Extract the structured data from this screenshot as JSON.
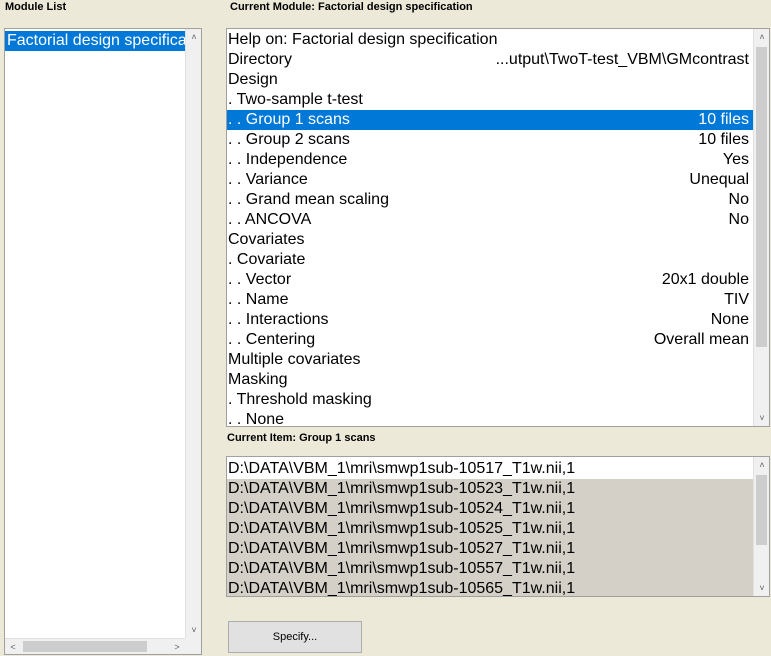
{
  "headers": {
    "module_list": "Module List",
    "current_module": "Current Module: Factorial design specification",
    "current_item": "Current Item: Group 1 scans"
  },
  "module_list": {
    "items": [
      {
        "label": "Factorial design specifica",
        "selected": true
      }
    ]
  },
  "settings": {
    "rows": [
      {
        "label": "Help on: Factorial design specification",
        "value": ""
      },
      {
        "label": "Directory",
        "value": "...utput\\TwoT-test_VBM\\GMcontrast"
      },
      {
        "label": "Design",
        "value": ""
      },
      {
        "label": ". Two-sample t-test",
        "value": ""
      },
      {
        "label": ". . Group 1 scans",
        "value": "10 files",
        "selected": true
      },
      {
        "label": ". . Group 2 scans",
        "value": "10 files"
      },
      {
        "label": ". . Independence",
        "value": "Yes"
      },
      {
        "label": ". . Variance",
        "value": "Unequal"
      },
      {
        "label": ". . Grand mean scaling",
        "value": "No"
      },
      {
        "label": ". . ANCOVA",
        "value": "No"
      },
      {
        "label": "Covariates",
        "value": ""
      },
      {
        "label": ". Covariate",
        "value": ""
      },
      {
        "label": ". . Vector",
        "value": "20x1 double"
      },
      {
        "label": ". . Name",
        "value": "TIV"
      },
      {
        "label": ". . Interactions",
        "value": "None"
      },
      {
        "label": ". . Centering",
        "value": "Overall mean"
      },
      {
        "label": "Multiple covariates",
        "value": ""
      },
      {
        "label": "Masking",
        "value": ""
      },
      {
        "label": ". Threshold masking",
        "value": ""
      },
      {
        "label": ". . None",
        "value": ""
      }
    ]
  },
  "current_item": {
    "files": [
      "D:\\DATA\\VBM_1\\mri\\smwp1sub-10517_T1w.nii,1",
      "D:\\DATA\\VBM_1\\mri\\smwp1sub-10523_T1w.nii,1",
      "D:\\DATA\\VBM_1\\mri\\smwp1sub-10524_T1w.nii,1",
      "D:\\DATA\\VBM_1\\mri\\smwp1sub-10525_T1w.nii,1",
      "D:\\DATA\\VBM_1\\mri\\smwp1sub-10527_T1w.nii,1",
      "D:\\DATA\\VBM_1\\mri\\smwp1sub-10557_T1w.nii,1",
      "D:\\DATA\\VBM_1\\mri\\smwp1sub-10565_T1w.nii,1"
    ]
  },
  "buttons": {
    "specify": "Specify..."
  },
  "icons": {
    "arrow_up": "chevron-up-icon",
    "arrow_down": "chevron-down-icon",
    "arrow_left": "chevron-left-icon",
    "arrow_right": "chevron-right-icon"
  },
  "colors": {
    "selection": "#0078d7",
    "background": "#ece9d8",
    "file_highlight": "#d4d0c8"
  }
}
